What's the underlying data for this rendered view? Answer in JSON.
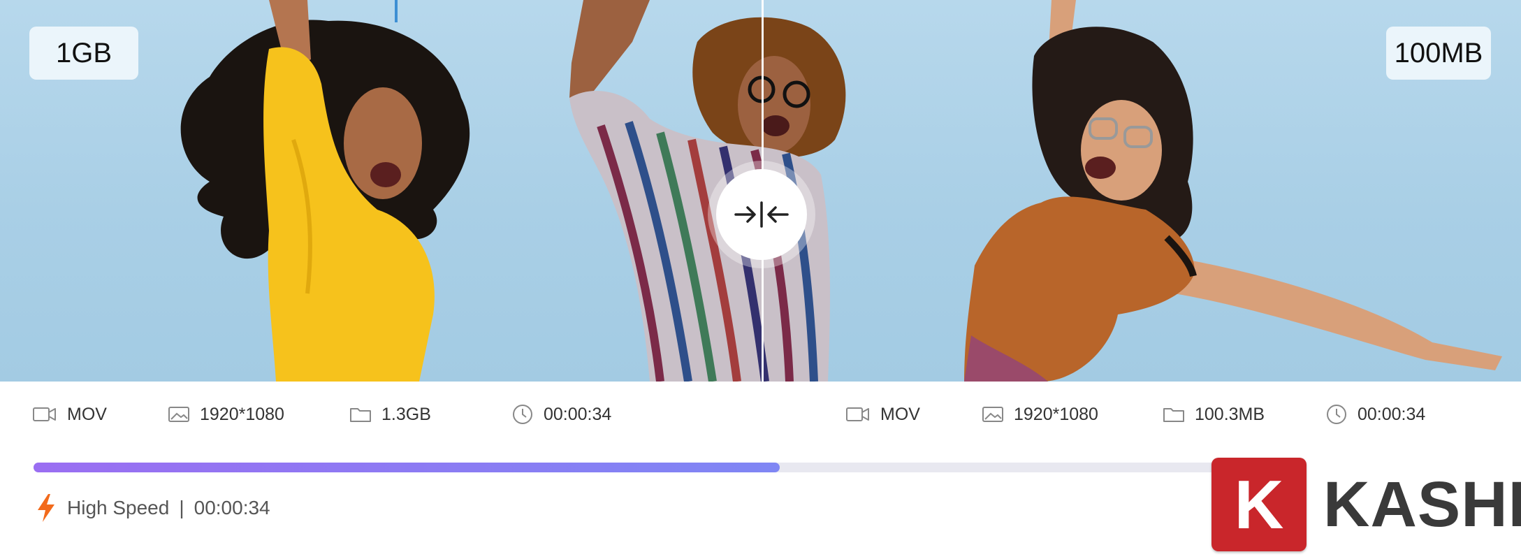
{
  "preview": {
    "original_size": "1GB",
    "compressed_size": "100MB",
    "compare_handle_icon": "compress-arrows-icon"
  },
  "original_meta": {
    "format": "MOV",
    "resolution": "1920*1080",
    "file_size": "1.3GB",
    "duration": "00:00:34"
  },
  "compressed_meta": {
    "format": "MOV",
    "resolution": "1920*1080",
    "file_size": "100.3MB",
    "duration": "00:00:34"
  },
  "progress": {
    "fraction": 0.6,
    "mode_label": "High Speed",
    "separator": "|",
    "elapsed": "00:00:34"
  },
  "watermark": {
    "letter": "K",
    "text": "KASHI"
  },
  "colors": {
    "sky": "#a9cfe6",
    "progress_start": "#9a6ef2",
    "progress_end": "#7f86f4",
    "bolt": "#f26a1b",
    "watermark_red": "#c9262b"
  }
}
